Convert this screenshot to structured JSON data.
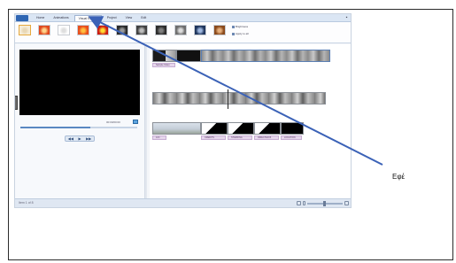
{
  "app": {
    "tabs": [
      "Home",
      "Animations",
      "Visual Effects",
      "Project",
      "View",
      "Edit"
    ],
    "active_tab": "Visual Effects",
    "ribbon_options": [
      "Brightness",
      "Apply to all"
    ],
    "effect_thumbs": [
      {
        "color": "#f6edd8",
        "accent": "#e8d7b5",
        "selected": true
      },
      {
        "color": "#e0491f",
        "accent": "#ffd48a"
      },
      {
        "color": "#ffffff",
        "accent": "#dedede"
      },
      {
        "color": "#e84d1c",
        "accent": "#ffbf40"
      },
      {
        "color": "#cc1a12",
        "accent": "#ffdb33"
      },
      {
        "color": "#2a2a2a",
        "accent": "#999999"
      },
      {
        "color": "#404040",
        "accent": "#bdbdbd"
      },
      {
        "color": "#2b2b2b",
        "accent": "#7f7f7f"
      },
      {
        "color": "#6e6e6e",
        "accent": "#dcdcdc"
      },
      {
        "color": "#1f355c",
        "accent": "#9fb8e0"
      },
      {
        "color": "#8a4a1c",
        "accent": "#e6b07d"
      }
    ]
  },
  "preview": {
    "time": "00:00/00:00",
    "controls": [
      "◀◀",
      "▶",
      "▶▶"
    ],
    "progress": 0.6
  },
  "storyboard": {
    "captions": [
      "Sample Video",
      "A Fi",
      "CREDITS",
      "STARRING",
      "DIRECTED B",
      "LOCATION"
    ]
  },
  "status": {
    "text": "Item 1 of 8"
  },
  "annotation": {
    "label": "Εφέ"
  },
  "colors": {
    "arrow": "#3b62b7",
    "caption_bg": "#e6d6ec"
  }
}
